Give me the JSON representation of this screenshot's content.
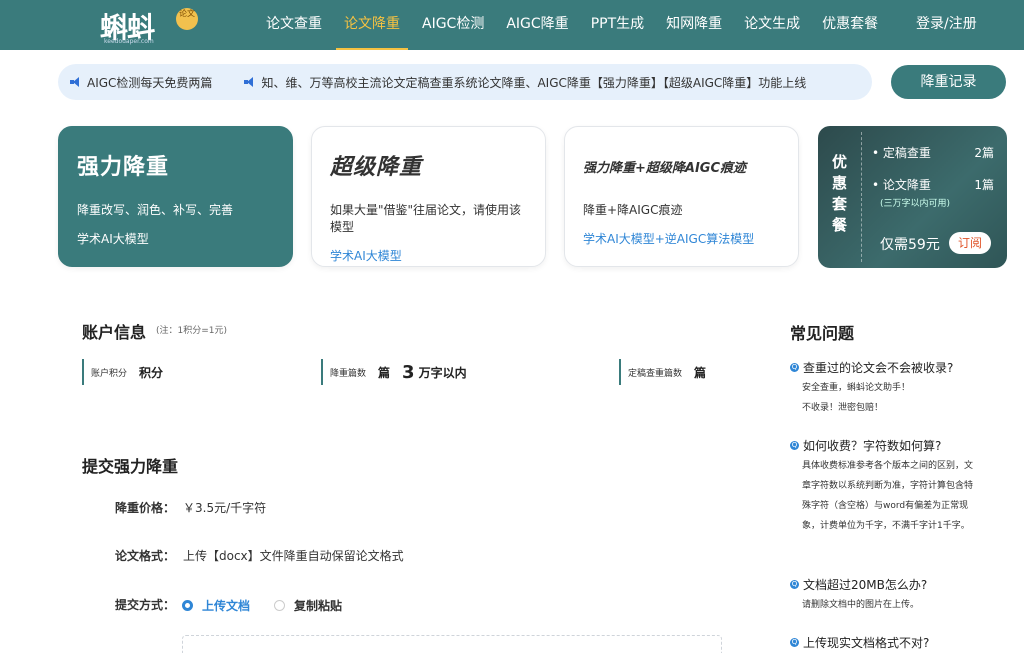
{
  "header": {
    "logo_text": "蝌蚪",
    "logo_badge": "论文",
    "logo_url": "keedouaper.com",
    "nav": [
      {
        "label": "论文查重",
        "active": false
      },
      {
        "label": "论文降重",
        "active": true
      },
      {
        "label": "AIGC检测",
        "active": false
      },
      {
        "label": "AIGC降重",
        "active": false
      },
      {
        "label": "PPT生成",
        "active": false
      },
      {
        "label": "知网降重",
        "active": false
      },
      {
        "label": "论文生成",
        "active": false
      },
      {
        "label": "优惠套餐",
        "active": false
      }
    ],
    "login": "登录/注册"
  },
  "notice": {
    "items": [
      "AIGC检测每天免费两篇",
      "知、维、万等高校主流论文定稿查重系统论文降重、AIGC降重【强力降重】【超级AIGC降重】功能上线"
    ],
    "record_button": "降重记录"
  },
  "cards": [
    {
      "title": "强力降重",
      "desc": "降重改写、润色、补写、完善",
      "link": "学术AI大模型",
      "selected": true
    },
    {
      "title": "超级降重",
      "desc": "如果大量\"借鉴\"往届论文，请使用该模型",
      "link": "学术AI大模型",
      "selected": false
    },
    {
      "title": "强力降重+超级降AIGC痕迹",
      "desc": "降重+降AIGC痕迹",
      "link": "学术AI大模型+逆AIGC算法模型",
      "selected": false
    }
  ],
  "package": {
    "side": "优惠套餐",
    "row1_label": "• 定稿查重",
    "row1_value": "2篇",
    "row2_label": "• 论文降重",
    "row2_value": "1篇",
    "row2_note": "(三万字以内可用)",
    "price": "仅需59元",
    "subscribe": "订阅"
  },
  "account": {
    "title": "账户信息",
    "note": "(注：1积分=1元)",
    "points_label": "账户积分",
    "points_value": "积分",
    "reduce_label": "降重篇数",
    "reduce_unit": "篇",
    "reduce_num": "3",
    "reduce_limit": "万字以内",
    "check_label": "定稿查重篇数",
    "check_unit": "篇"
  },
  "submit": {
    "title": "提交强力降重",
    "price_label": "降重价格：",
    "price_value": "￥3.5元/千字符",
    "format_label": "论文格式：",
    "format_value": "上传【docx】文件降重自动保留论文格式",
    "method_label": "提交方式：",
    "upload_option": "上传文档",
    "paste_option": "复制粘贴"
  },
  "faq": {
    "title": "常见问题",
    "items": [
      {
        "q": "查重过的论文会不会被收录?",
        "a": "安全查重，蝌蚪论文助手！\n不收录！泄密包赔！"
      },
      {
        "q": "如何收费？字符数如何算?",
        "a": "具体收费标准参考各个版本之间的区别，文章字符数以系统判断为准，字符计算包含特殊字符（含空格）与word有偏差为正常现象，计费单位为千字，不满千字计1千字。"
      },
      {
        "q": "文档超过20MB怎么办?",
        "a": "请删除文档中的图片在上传。"
      },
      {
        "q": "上传现实文档格式不对?",
        "a": ""
      }
    ]
  }
}
